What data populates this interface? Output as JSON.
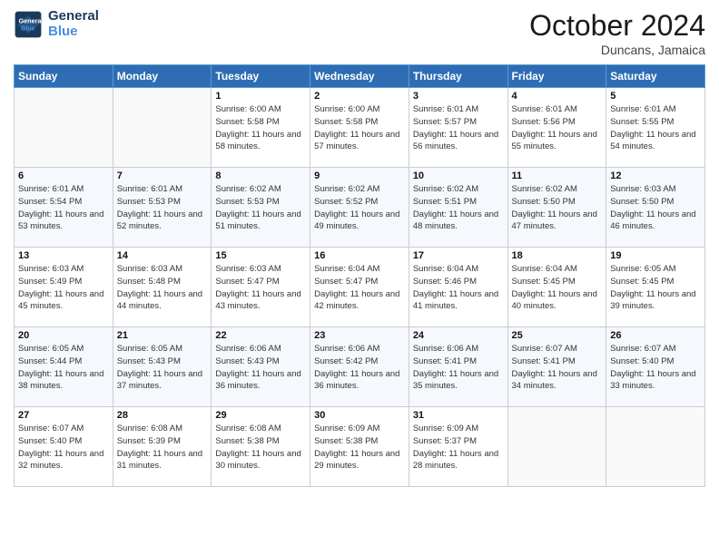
{
  "header": {
    "logo_line1": "General",
    "logo_line2": "Blue",
    "month": "October 2024",
    "location": "Duncans, Jamaica"
  },
  "days_of_week": [
    "Sunday",
    "Monday",
    "Tuesday",
    "Wednesday",
    "Thursday",
    "Friday",
    "Saturday"
  ],
  "weeks": [
    [
      {
        "day": "",
        "info": ""
      },
      {
        "day": "",
        "info": ""
      },
      {
        "day": "1",
        "info": "Sunrise: 6:00 AM\nSunset: 5:58 PM\nDaylight: 11 hours and 58 minutes."
      },
      {
        "day": "2",
        "info": "Sunrise: 6:00 AM\nSunset: 5:58 PM\nDaylight: 11 hours and 57 minutes."
      },
      {
        "day": "3",
        "info": "Sunrise: 6:01 AM\nSunset: 5:57 PM\nDaylight: 11 hours and 56 minutes."
      },
      {
        "day": "4",
        "info": "Sunrise: 6:01 AM\nSunset: 5:56 PM\nDaylight: 11 hours and 55 minutes."
      },
      {
        "day": "5",
        "info": "Sunrise: 6:01 AM\nSunset: 5:55 PM\nDaylight: 11 hours and 54 minutes."
      }
    ],
    [
      {
        "day": "6",
        "info": "Sunrise: 6:01 AM\nSunset: 5:54 PM\nDaylight: 11 hours and 53 minutes."
      },
      {
        "day": "7",
        "info": "Sunrise: 6:01 AM\nSunset: 5:53 PM\nDaylight: 11 hours and 52 minutes."
      },
      {
        "day": "8",
        "info": "Sunrise: 6:02 AM\nSunset: 5:53 PM\nDaylight: 11 hours and 51 minutes."
      },
      {
        "day": "9",
        "info": "Sunrise: 6:02 AM\nSunset: 5:52 PM\nDaylight: 11 hours and 49 minutes."
      },
      {
        "day": "10",
        "info": "Sunrise: 6:02 AM\nSunset: 5:51 PM\nDaylight: 11 hours and 48 minutes."
      },
      {
        "day": "11",
        "info": "Sunrise: 6:02 AM\nSunset: 5:50 PM\nDaylight: 11 hours and 47 minutes."
      },
      {
        "day": "12",
        "info": "Sunrise: 6:03 AM\nSunset: 5:50 PM\nDaylight: 11 hours and 46 minutes."
      }
    ],
    [
      {
        "day": "13",
        "info": "Sunrise: 6:03 AM\nSunset: 5:49 PM\nDaylight: 11 hours and 45 minutes."
      },
      {
        "day": "14",
        "info": "Sunrise: 6:03 AM\nSunset: 5:48 PM\nDaylight: 11 hours and 44 minutes."
      },
      {
        "day": "15",
        "info": "Sunrise: 6:03 AM\nSunset: 5:47 PM\nDaylight: 11 hours and 43 minutes."
      },
      {
        "day": "16",
        "info": "Sunrise: 6:04 AM\nSunset: 5:47 PM\nDaylight: 11 hours and 42 minutes."
      },
      {
        "day": "17",
        "info": "Sunrise: 6:04 AM\nSunset: 5:46 PM\nDaylight: 11 hours and 41 minutes."
      },
      {
        "day": "18",
        "info": "Sunrise: 6:04 AM\nSunset: 5:45 PM\nDaylight: 11 hours and 40 minutes."
      },
      {
        "day": "19",
        "info": "Sunrise: 6:05 AM\nSunset: 5:45 PM\nDaylight: 11 hours and 39 minutes."
      }
    ],
    [
      {
        "day": "20",
        "info": "Sunrise: 6:05 AM\nSunset: 5:44 PM\nDaylight: 11 hours and 38 minutes."
      },
      {
        "day": "21",
        "info": "Sunrise: 6:05 AM\nSunset: 5:43 PM\nDaylight: 11 hours and 37 minutes."
      },
      {
        "day": "22",
        "info": "Sunrise: 6:06 AM\nSunset: 5:43 PM\nDaylight: 11 hours and 36 minutes."
      },
      {
        "day": "23",
        "info": "Sunrise: 6:06 AM\nSunset: 5:42 PM\nDaylight: 11 hours and 36 minutes."
      },
      {
        "day": "24",
        "info": "Sunrise: 6:06 AM\nSunset: 5:41 PM\nDaylight: 11 hours and 35 minutes."
      },
      {
        "day": "25",
        "info": "Sunrise: 6:07 AM\nSunset: 5:41 PM\nDaylight: 11 hours and 34 minutes."
      },
      {
        "day": "26",
        "info": "Sunrise: 6:07 AM\nSunset: 5:40 PM\nDaylight: 11 hours and 33 minutes."
      }
    ],
    [
      {
        "day": "27",
        "info": "Sunrise: 6:07 AM\nSunset: 5:40 PM\nDaylight: 11 hours and 32 minutes."
      },
      {
        "day": "28",
        "info": "Sunrise: 6:08 AM\nSunset: 5:39 PM\nDaylight: 11 hours and 31 minutes."
      },
      {
        "day": "29",
        "info": "Sunrise: 6:08 AM\nSunset: 5:38 PM\nDaylight: 11 hours and 30 minutes."
      },
      {
        "day": "30",
        "info": "Sunrise: 6:09 AM\nSunset: 5:38 PM\nDaylight: 11 hours and 29 minutes."
      },
      {
        "day": "31",
        "info": "Sunrise: 6:09 AM\nSunset: 5:37 PM\nDaylight: 11 hours and 28 minutes."
      },
      {
        "day": "",
        "info": ""
      },
      {
        "day": "",
        "info": ""
      }
    ]
  ]
}
